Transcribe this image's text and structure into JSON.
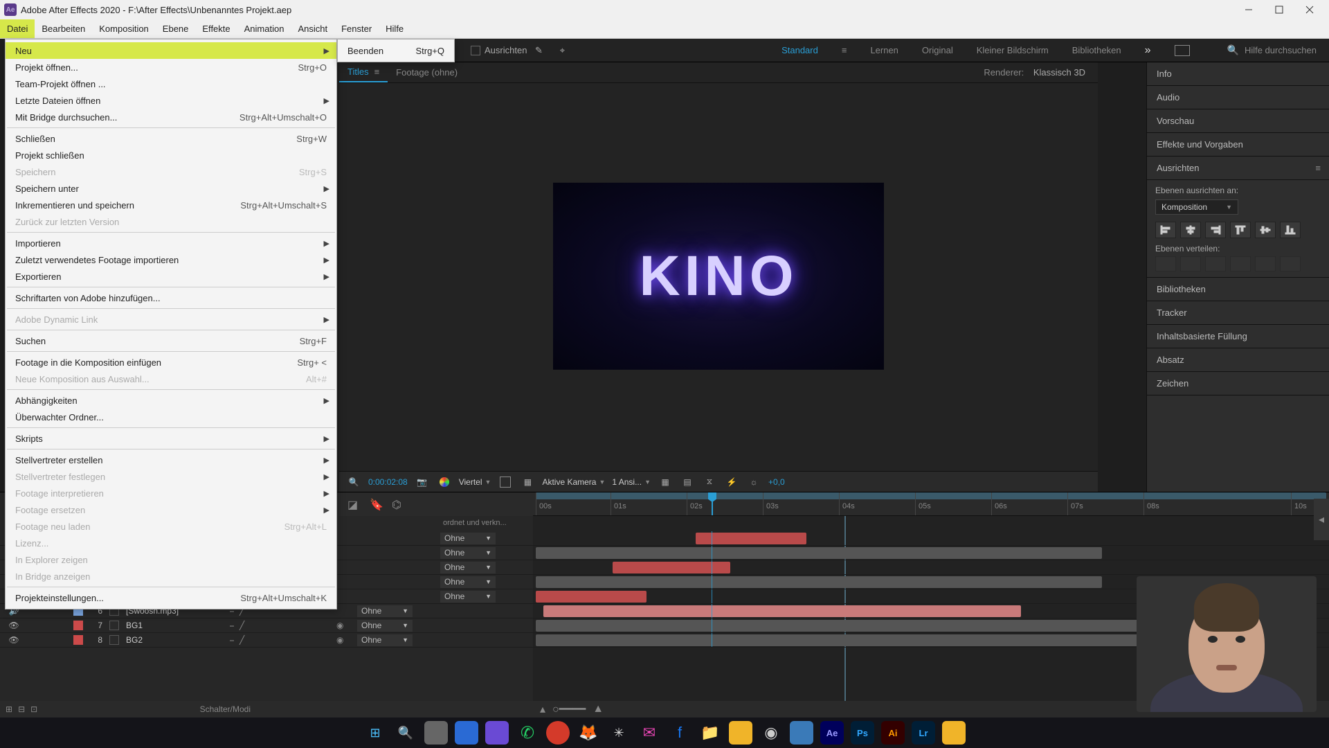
{
  "titlebar": {
    "app_title": "Adobe After Effects 2020 - F:\\After Effects\\Unbenanntes Projekt.aep"
  },
  "menubar": {
    "items": [
      "Datei",
      "Bearbeiten",
      "Komposition",
      "Ebene",
      "Effekte",
      "Animation",
      "Ansicht",
      "Fenster",
      "Hilfe"
    ],
    "active": "Datei"
  },
  "dropdown": {
    "items": [
      {
        "label": "Neu",
        "arrow": true,
        "highlight": true
      },
      {
        "label": "Projekt öffnen...",
        "hk": "Strg+O"
      },
      {
        "label": "Team-Projekt öffnen ..."
      },
      {
        "label": "Letzte Dateien öffnen",
        "arrow": true
      },
      {
        "label": "Mit Bridge durchsuchen...",
        "hk": "Strg+Alt+Umschalt+O"
      },
      {
        "sep": true
      },
      {
        "label": "Schließen",
        "hk": "Strg+W"
      },
      {
        "label": "Projekt schließen"
      },
      {
        "label": "Speichern",
        "hk": "Strg+S",
        "disabled": true
      },
      {
        "label": "Speichern unter",
        "arrow": true
      },
      {
        "label": "Inkrementieren und speichern",
        "hk": "Strg+Alt+Umschalt+S"
      },
      {
        "label": "Zurück zur letzten Version",
        "disabled": true
      },
      {
        "sep": true
      },
      {
        "label": "Importieren",
        "arrow": true
      },
      {
        "label": "Zuletzt verwendetes Footage importieren",
        "arrow": true
      },
      {
        "label": "Exportieren",
        "arrow": true
      },
      {
        "sep": true
      },
      {
        "label": "Schriftarten von Adobe hinzufügen..."
      },
      {
        "sep": true
      },
      {
        "label": "Adobe Dynamic Link",
        "arrow": true,
        "disabled": true
      },
      {
        "sep": true
      },
      {
        "label": "Suchen",
        "hk": "Strg+F"
      },
      {
        "sep": true
      },
      {
        "label": "Footage in die Komposition einfügen",
        "hk": "Strg+ <"
      },
      {
        "label": "Neue Komposition aus Auswahl...",
        "hk": "Alt+#",
        "disabled": true
      },
      {
        "sep": true
      },
      {
        "label": "Abhängigkeiten",
        "arrow": true
      },
      {
        "label": "Überwachter Ordner..."
      },
      {
        "sep": true
      },
      {
        "label": "Skripts",
        "arrow": true
      },
      {
        "sep": true
      },
      {
        "label": "Stellvertreter erstellen",
        "arrow": true
      },
      {
        "label": "Stellvertreter festlegen",
        "arrow": true,
        "disabled": true
      },
      {
        "label": "Footage interpretieren",
        "arrow": true,
        "disabled": true
      },
      {
        "label": "Footage ersetzen",
        "arrow": true,
        "disabled": true
      },
      {
        "label": "Footage neu laden",
        "hk": "Strg+Alt+L",
        "disabled": true
      },
      {
        "label": "Lizenz...",
        "disabled": true
      },
      {
        "label": "In Explorer zeigen",
        "disabled": true
      },
      {
        "label": "In Bridge anzeigen",
        "disabled": true
      },
      {
        "sep": true
      },
      {
        "label": "Projekteinstellungen...",
        "hk": "Strg+Alt+Umschalt+K"
      }
    ]
  },
  "submenu": {
    "label": "Beenden",
    "hk": "Strg+Q"
  },
  "toolbar": {
    "snap_label": "Ausrichten",
    "workspaces": [
      "Standard",
      "Lernen",
      "Original",
      "Kleiner Bildschirm",
      "Bibliotheken"
    ],
    "active_ws": "Standard",
    "search_placeholder": "Hilfe durchsuchen"
  },
  "tabs": {
    "active": "Titles",
    "other": "Footage  (ohne)",
    "renderer_label": "Renderer:",
    "renderer_value": "Klassisch 3D"
  },
  "preview": {
    "text": "KINO",
    "timecode": "0:00:02:08",
    "quality": "Viertel",
    "camera": "Aktive Kamera",
    "views": "1 Ansi...",
    "exposure": "+0,0"
  },
  "rightpanels": {
    "items": [
      "Info",
      "Audio",
      "Vorschau",
      "Effekte und Vorgaben"
    ],
    "align_title": "Ausrichten",
    "align_label": "Ebenen ausrichten an:",
    "align_target": "Komposition",
    "dist_label": "Ebenen verteilen:",
    "more": [
      "Bibliotheken",
      "Tracker",
      "Inhaltsbasierte Füllung",
      "Absatz",
      "Zeichen"
    ]
  },
  "timeline": {
    "header_hint": "ordnet und verkn...",
    "layers": [
      {
        "num": "6",
        "color": "#7aa6e0",
        "name": "[Swoosh.mp3]",
        "parent": "Ohne",
        "audio": true
      },
      {
        "num": "7",
        "color": "#cc4a4a",
        "name": "BG1",
        "parent": "Ohne"
      },
      {
        "num": "8",
        "color": "#cc4a4a",
        "name": "BG2",
        "parent": "Ohne"
      }
    ],
    "hidden_parent": "Ohne",
    "ruler": [
      "00s",
      "01s",
      "02s",
      "03s",
      "04s",
      "05s",
      "06s",
      "07s",
      "08s",
      "10s"
    ],
    "footer": "Schalter/Modi"
  }
}
